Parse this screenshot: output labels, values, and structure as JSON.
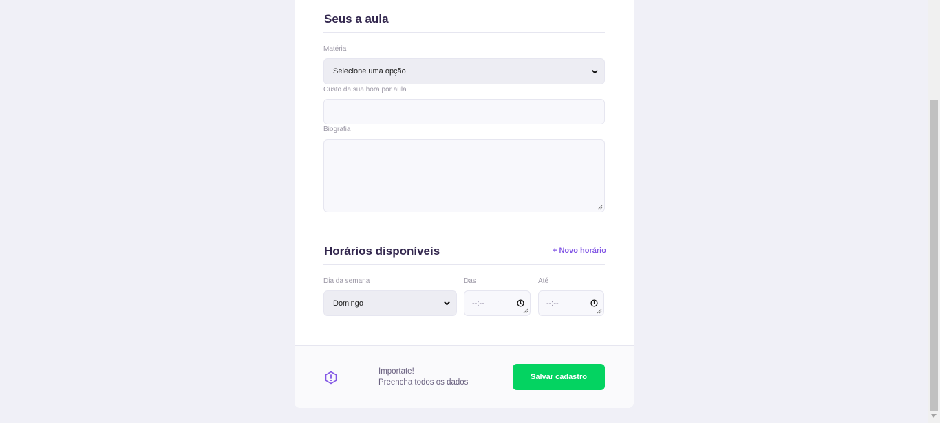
{
  "class_section": {
    "title": "Seus a aula",
    "subject": {
      "label": "Matéria",
      "value": "Selecione uma opção"
    },
    "cost": {
      "label": "Custo da sua hora por aula",
      "value": ""
    },
    "bio": {
      "label": "Biografia",
      "value": ""
    }
  },
  "schedule_section": {
    "title": "Horários disponíveis",
    "new_link": "+ Novo horário",
    "weekday": {
      "label": "Dia da semana",
      "value": "Domingo"
    },
    "from": {
      "label": "Das",
      "value": "--:--"
    },
    "to": {
      "label": "Até",
      "value": "--:--"
    }
  },
  "footer": {
    "warning_title": "Importate!",
    "warning_text": "Preencha todos os dados",
    "save_label": "Salvar cadastro"
  },
  "colors": {
    "accent": "#8257e5",
    "save_button": "#04d361",
    "background": "#f0f0f7",
    "title_text": "#32264d"
  },
  "icons": [
    "chevron-down-icon",
    "clock-icon",
    "warning-icon"
  ]
}
